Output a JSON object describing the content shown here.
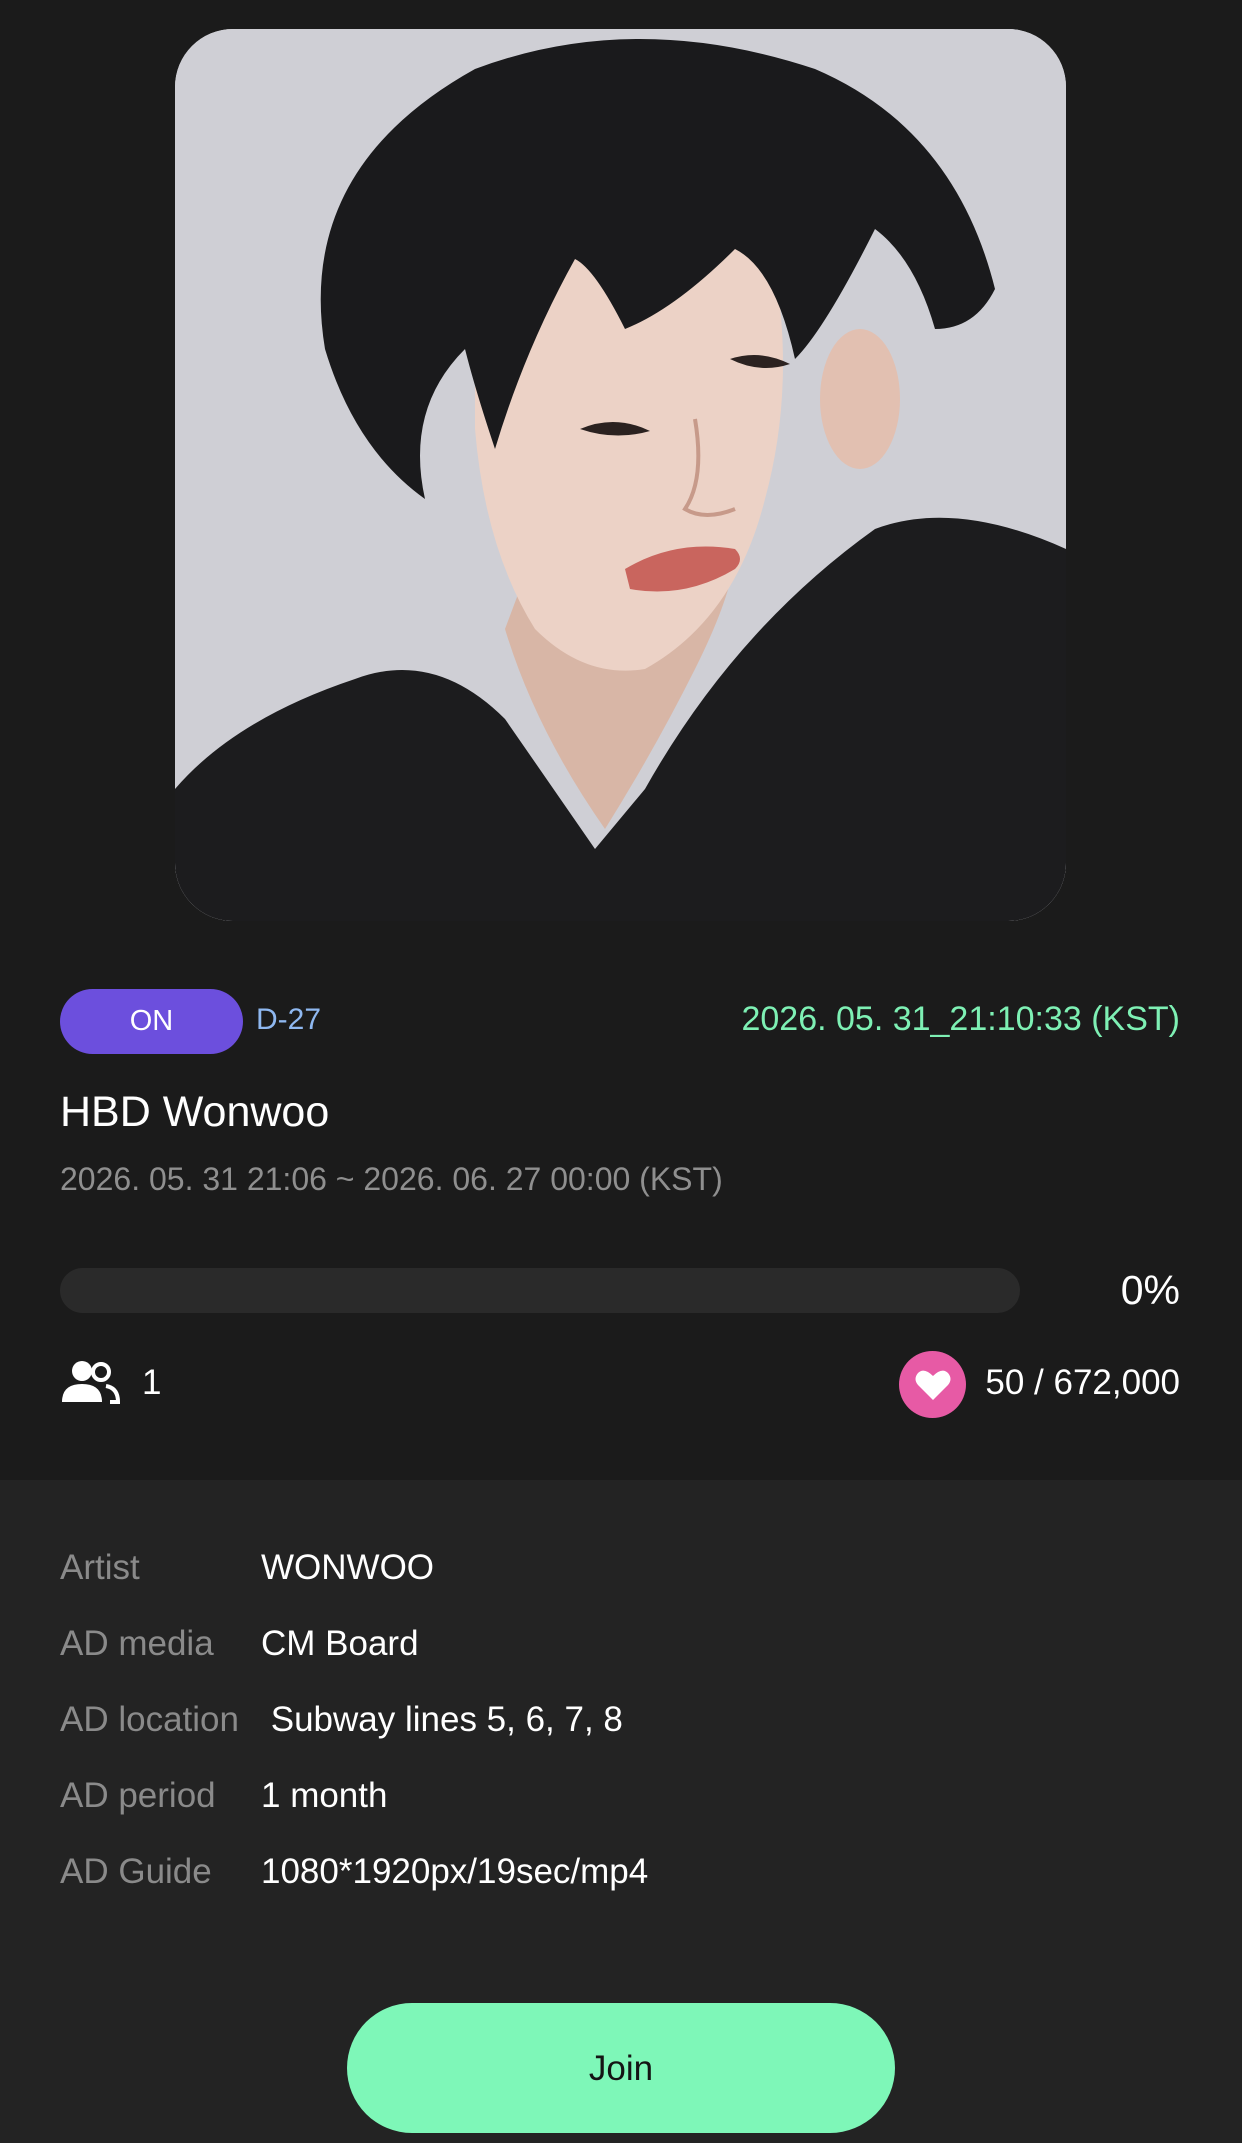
{
  "campaign": {
    "status_badge": "ON",
    "d_day": "D-27",
    "current_time": "2026. 05. 31_21:10:33 (KST)",
    "title": "HBD Wonwoo",
    "period": "2026. 05. 31 21:06 ~ 2026. 06. 27 00:00 (KST)",
    "progress_percent": 0,
    "progress_label": "0%",
    "participants": "1",
    "votes": "50 / 672,000"
  },
  "details": [
    {
      "label": "Artist",
      "value": "WONWOO"
    },
    {
      "label": "AD media",
      "value": "CM Board"
    },
    {
      "label": "AD location",
      "value": " Subway lines 5, 6, 7, 8"
    },
    {
      "label": "AD period",
      "value": "1 month"
    },
    {
      "label": "AD Guide",
      "value": "1080*1920px/19sec/mp4"
    }
  ],
  "actions": {
    "join_label": "Join"
  },
  "icons": {
    "participants": "people-icon",
    "votes": "heart-icon"
  },
  "colors": {
    "badge": "#6c4fdd",
    "accent_green": "#7ef0b4",
    "heart": "#e75aa5",
    "d_day": "#8fb8f0"
  }
}
